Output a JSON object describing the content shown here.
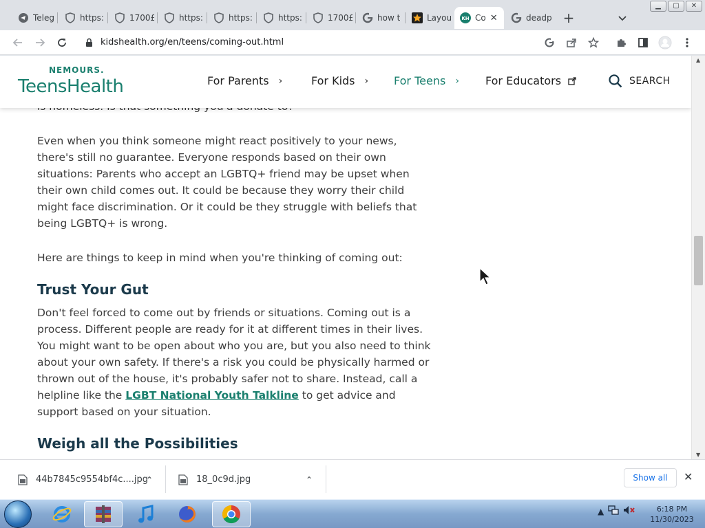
{
  "browser": {
    "tabs": [
      {
        "title": "Telegr",
        "icon": "telegram-icon"
      },
      {
        "title": "https:",
        "icon": "shield-icon"
      },
      {
        "title": "1700£",
        "icon": "shield-icon"
      },
      {
        "title": "https:",
        "icon": "shield-icon"
      },
      {
        "title": "https:",
        "icon": "shield-icon"
      },
      {
        "title": "https:",
        "icon": "shield-icon"
      },
      {
        "title": "1700£",
        "icon": "shield-icon"
      },
      {
        "title": "how t",
        "icon": "google-icon"
      },
      {
        "title": "Layou",
        "icon": "star-icon"
      },
      {
        "title": "Co",
        "icon": "kidshealth-icon",
        "active": true
      },
      {
        "title": "deadp",
        "icon": "google-icon"
      }
    ],
    "new_tab_label": "+",
    "url": "kidshealth.org/en/teens/coming-out.html"
  },
  "site": {
    "brand_small": "NEMOURS.",
    "brand_big": "TeensHealth",
    "nav": [
      {
        "label": "For Parents"
      },
      {
        "label": "For Kids"
      },
      {
        "label": "For Teens",
        "active": true
      },
      {
        "label": "For Educators"
      }
    ],
    "search_label": "SEARCH",
    "accent_color": "#1a7f6e"
  },
  "article": {
    "partial_line": "is homeless. Is that something you'd donate to?",
    "para1": "Even when you think someone might react positively to your news, there's still no guarantee. Everyone responds based on their own situations: Parents who accept an LGBTQ+ friend may be upset when their own child comes out. It could be because they worry their child might face discrimination. Or it could be they struggle with beliefs that being LGBTQ+ is wrong.",
    "para2": "Here are things to keep in mind when you're thinking of coming out:",
    "heading1": "Trust Your Gut",
    "para3_before": "Don't feel forced to come out by friends or situations. Coming out is a process. Different people are ready for it at different times in their lives. You might want to be open about who you are, but you also need to think about your own safety. If there's a risk you could be physically harmed or thrown out of the house, it's probably safer not to share. Instead, call a helpline like the ",
    "para3_link": "LGBT National Youth Talkline",
    "para3_after": " to get advice and support based on your situation.",
    "heading2": "Weigh all the Possibilities"
  },
  "downloads": {
    "items": [
      {
        "name": "44b7845c9554bf4c....jpg"
      },
      {
        "name": "18_0c9d.jpg"
      }
    ],
    "show_all": "Show all"
  },
  "taskbar": {
    "apps": [
      "explorer-icon",
      "internet-explorer-icon",
      "winrar-icon",
      "itunes-icon",
      "firefox-icon",
      "chrome-icon"
    ],
    "time": "6:18 PM",
    "date": "11/30/2023"
  }
}
